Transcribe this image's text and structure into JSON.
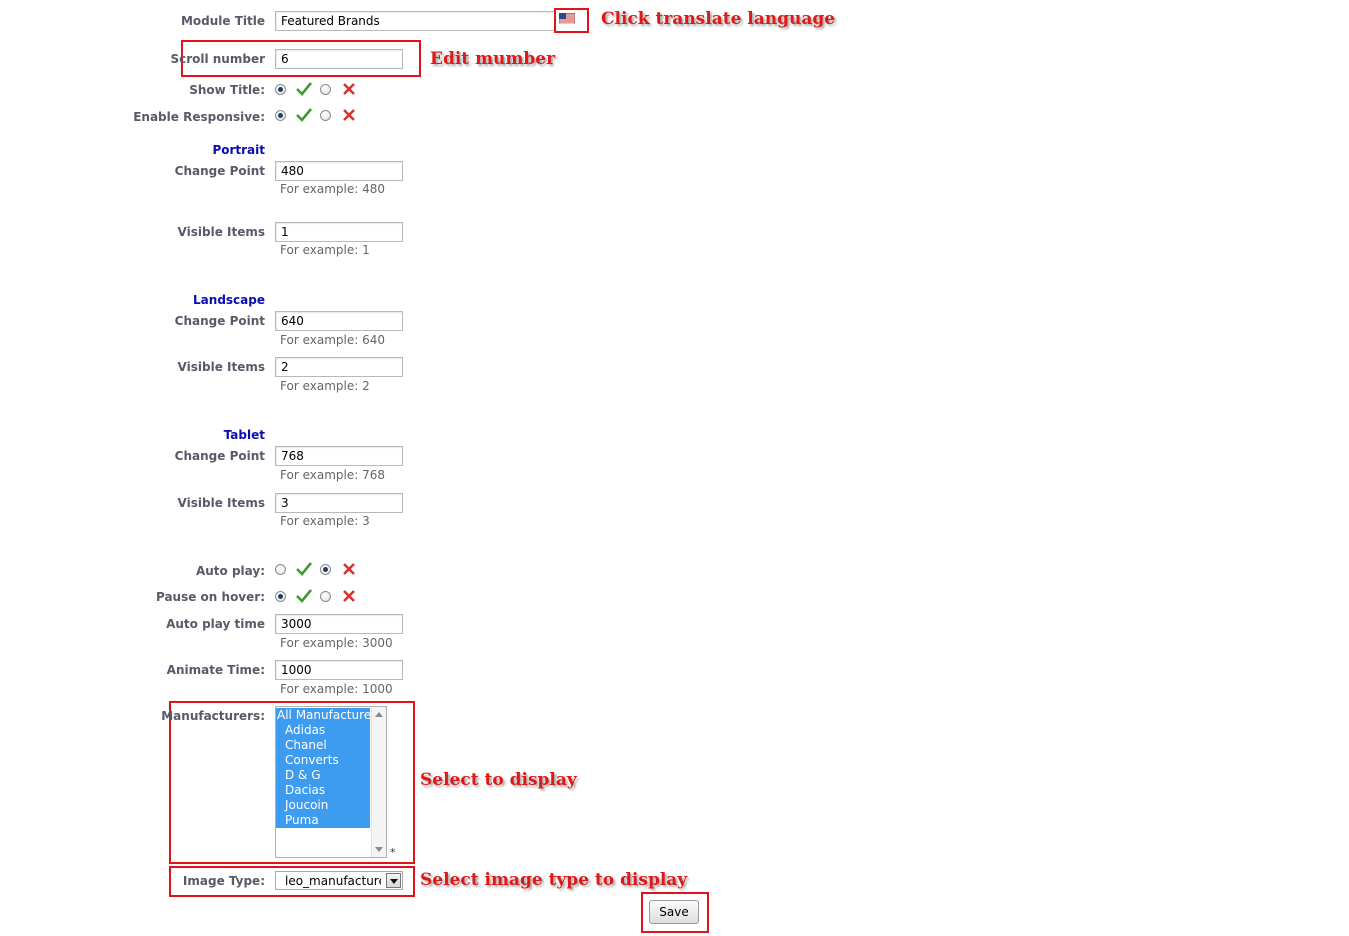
{
  "form": {
    "module_title": {
      "label": "Module Title",
      "value": "Featured Brands"
    },
    "scroll_number": {
      "label": "Scroll number",
      "value": "6"
    },
    "show_title": {
      "label": "Show Title:",
      "selected": "yes"
    },
    "enable_responsive": {
      "label": "Enable Responsive:",
      "selected": "yes"
    },
    "portrait": {
      "heading": "Portrait",
      "change_point": {
        "label": "Change Point",
        "value": "480",
        "hint": "For example: 480"
      },
      "visible_items": {
        "label": "Visible Items",
        "value": "1",
        "hint": "For example: 1"
      }
    },
    "landscape": {
      "heading": "Landscape",
      "change_point": {
        "label": "Change Point",
        "value": "640",
        "hint": "For example: 640"
      },
      "visible_items": {
        "label": "Visible Items",
        "value": "2",
        "hint": "For example: 2"
      }
    },
    "tablet": {
      "heading": "Tablet",
      "change_point": {
        "label": "Change Point",
        "value": "768",
        "hint": "For example: 768"
      },
      "visible_items": {
        "label": "Visible Items",
        "value": "3",
        "hint": "For example: 3"
      }
    },
    "auto_play": {
      "label": "Auto play:",
      "selected": "no"
    },
    "pause_on_hover": {
      "label": "Pause on hover:",
      "selected": "yes"
    },
    "auto_play_time": {
      "label": "Auto play time",
      "value": "3000",
      "hint": "For example: 3000"
    },
    "animate_time": {
      "label": "Animate Time:",
      "value": "1000",
      "hint": "For example: 1000"
    },
    "manufacturers": {
      "label": "Manufacturers:",
      "required_mark": "*",
      "options": [
        "All Manufacturers",
        "Adidas",
        "Chanel",
        "Converts",
        "D & G",
        "Dacias",
        "Joucoin",
        "Puma"
      ]
    },
    "image_type": {
      "label": "Image Type:",
      "value": "leo_manufacture"
    },
    "save_label": "Save"
  },
  "annotations": {
    "translate": "Click translate language",
    "edit_number": "Edit mumber",
    "select_display": "Select to display",
    "select_image_type": "Select image type to display"
  },
  "colors": {
    "annotation_red": "#e01818",
    "section_blue": "#0b0bb3",
    "selected_option": "#3d9bf0",
    "check_green": "#3d9a2f",
    "cross_red": "#d9342b"
  },
  "icons": {
    "yes": "check-icon",
    "no": "cross-icon",
    "flag": "us-flag-icon"
  }
}
